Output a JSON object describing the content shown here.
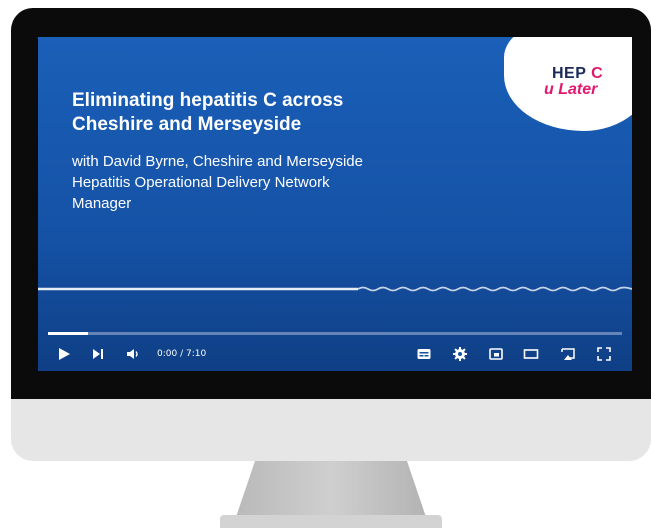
{
  "video": {
    "title": "Eliminating hepatitis C across Cheshire and Merseyside",
    "subtitle": "with David Byrne, Cheshire and Merseyside Hepatitis Operational Delivery Network Manager",
    "logo": {
      "line1": "HEP",
      "line1_accent": "C",
      "line2": "u Later",
      "accent_color": "#e0196e",
      "dark_color": "#1b2a59"
    },
    "background_color": "#1552a6"
  },
  "player": {
    "time_display": "0:00 / 7:10",
    "progress_fraction": 0.07,
    "buttons": [
      {
        "name": "play-icon"
      },
      {
        "name": "next-icon"
      },
      {
        "name": "volume-icon"
      },
      {
        "name": "subtitles-icon"
      },
      {
        "name": "settings-gear-icon"
      },
      {
        "name": "miniplayer-icon"
      },
      {
        "name": "theater-mode-icon"
      },
      {
        "name": "cast-icon"
      },
      {
        "name": "fullscreen-icon"
      }
    ]
  }
}
